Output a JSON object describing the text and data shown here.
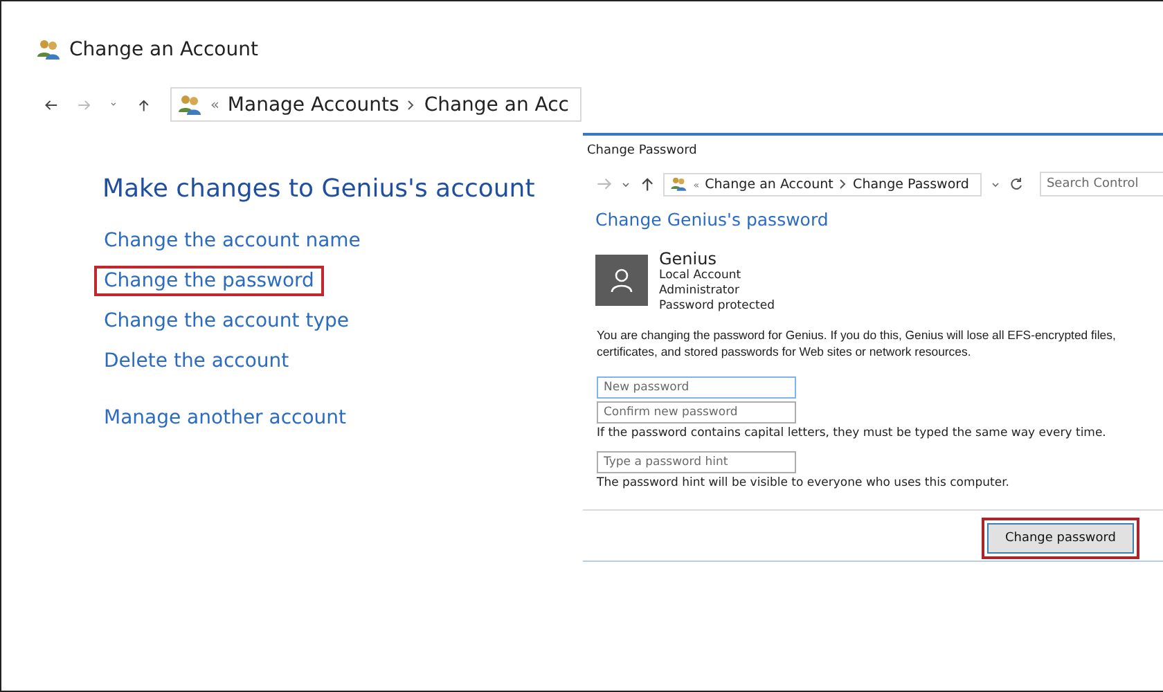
{
  "window": {
    "title": "Change an Account"
  },
  "address_bar": {
    "chevron": "«",
    "crumbs": [
      "Manage Accounts",
      "Change an Acc"
    ]
  },
  "heading": "Make changes to Genius's account",
  "links": [
    {
      "label": "Change the account name",
      "highlighted": false
    },
    {
      "label": "Change the password",
      "highlighted": true
    },
    {
      "label": "Change the account type",
      "highlighted": false
    },
    {
      "label": "Delete the account",
      "highlighted": false
    },
    {
      "label": "Manage another account",
      "highlighted": false
    }
  ],
  "dialog": {
    "title": "Change Password",
    "address_bar": {
      "chevron": "«",
      "crumbs": [
        "Change an Account",
        "Change Password"
      ]
    },
    "search": {
      "placeholder": "Search Control"
    },
    "heading": "Change Genius's password",
    "account": {
      "name": "Genius",
      "details": [
        "Local Account",
        "Administrator",
        "Password protected"
      ]
    },
    "warning": "You are changing the password for Genius.  If you do this, Genius will lose all EFS-encrypted files, certificates, and stored passwords for Web sites or network resources.",
    "fields": [
      {
        "placeholder": "New password",
        "focused": true
      },
      {
        "placeholder": "Confirm new password",
        "focused": false
      }
    ],
    "capital_note": "If the password contains capital letters, they must be typed the same way every time.",
    "hint_field": {
      "placeholder": "Type a password hint"
    },
    "hint_note": "The password hint will be visible to everyone who uses this computer.",
    "button": {
      "label": "Change password",
      "highlighted": true
    }
  }
}
